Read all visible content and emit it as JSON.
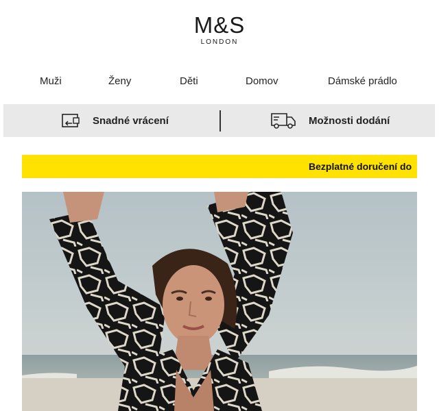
{
  "brand": {
    "name": "M&S",
    "subline": "LONDON"
  },
  "nav": {
    "items": [
      {
        "label": "Muži"
      },
      {
        "label": "Ženy"
      },
      {
        "label": "Děti"
      },
      {
        "label": "Domov"
      },
      {
        "label": "Dámské prádlo"
      }
    ]
  },
  "service_strip": {
    "returns_label": "Snadné vrácení",
    "returns_icon": "return-box-icon",
    "delivery_label": "Možnosti dodání",
    "delivery_icon": "delivery-truck-icon"
  },
  "promo_banner": {
    "text": "Bezplatné doručení do",
    "background": "#ffe200"
  },
  "hero": {
    "description_icon": "hero-photo"
  },
  "colors": {
    "strip_bg": "#e9e9e9",
    "promo_yellow": "#ffe200",
    "text": "#222222"
  }
}
